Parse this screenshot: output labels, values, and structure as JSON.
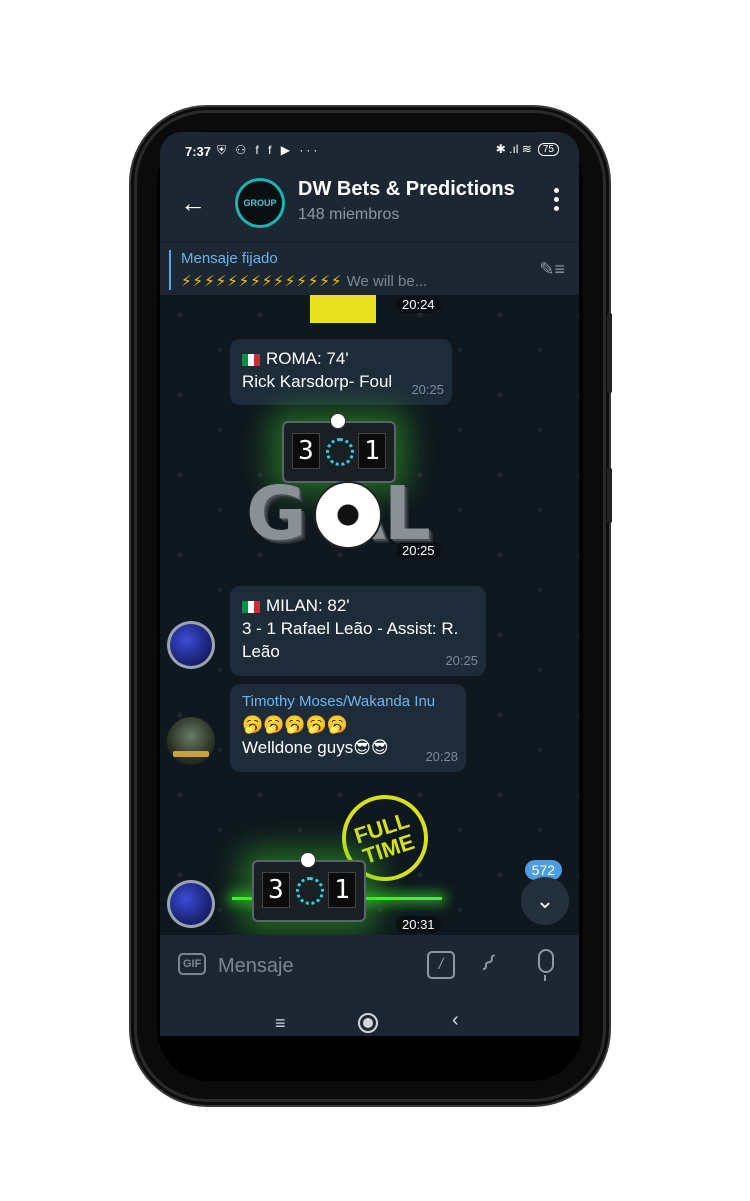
{
  "status_bar": {
    "time": "7:37",
    "left_icons": "⛨ ⚇ f f ▶ ···",
    "right_icons": "✱ .ıl ≋",
    "battery": "75"
  },
  "header": {
    "title": "DW Bets & Predictions",
    "subtitle": "148 miembros",
    "avatar_text": "GROUP"
  },
  "pinned": {
    "label": "Mensaje fijado",
    "bolts": "⚡⚡⚡⚡⚡⚡⚡⚡⚡⚡⚡⚡⚡⚡",
    "text": "We will be..."
  },
  "messages": {
    "sticker1_time": "20:24",
    "msg1": {
      "line1": "ROMA: 74'",
      "line2": "Rick Karsdorp- Foul",
      "time": "20:25"
    },
    "goal_sticker": {
      "home": "3",
      "away": "1",
      "text": "G  AL",
      "time": "20:25"
    },
    "msg2": {
      "line1": "MILAN: 82'",
      "line2": "3 - 1 Rafael Leão - Assist: R.",
      "line3": "Leão",
      "time": "20:25"
    },
    "msg3": {
      "sender": "Timothy Moses/Wakanda Inu",
      "line1": "🥱🥱🥱🥱🥱",
      "line2": "Welldone guys😎😎",
      "time": "20:28"
    },
    "fulltime_sticker": {
      "text": "FULL TIME",
      "home": "3",
      "away": "1",
      "time": "20:31"
    }
  },
  "scroll_badge": "572",
  "input": {
    "placeholder": "Mensaje",
    "gif_label": "GIF",
    "command_icon": "/"
  },
  "nav": {
    "menu": "≡",
    "back": "‹"
  }
}
